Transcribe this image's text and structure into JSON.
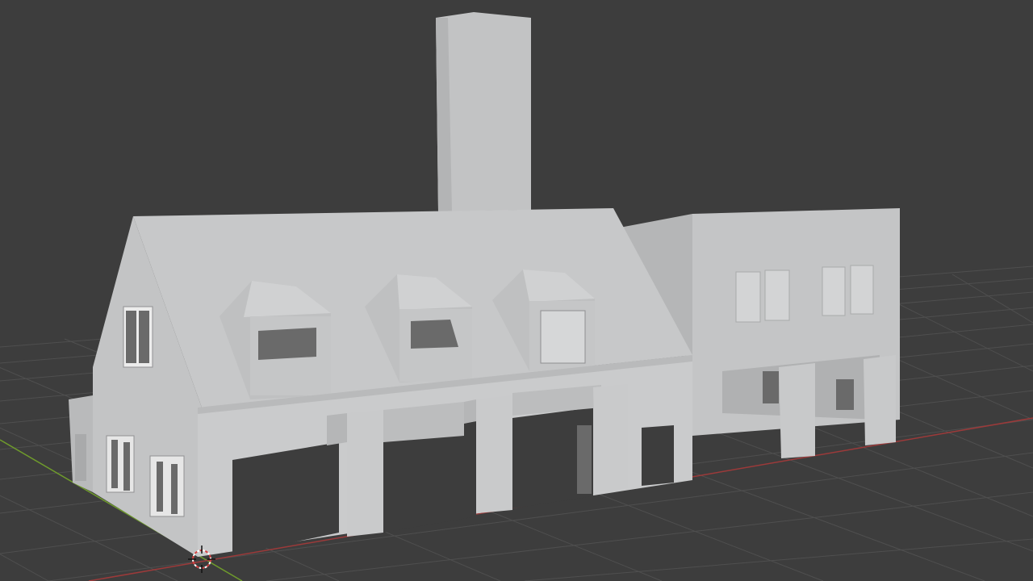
{
  "viewport": {
    "mode": "3d-viewport",
    "shading": "solid",
    "colors": {
      "background": "#3d3d3d",
      "grid_line": "#4e4e4e",
      "x_axis": "#9c3a3a",
      "y_axis": "#6f9b2c",
      "model_light": "#c9cacb",
      "model_mid": "#b7b8b9",
      "model_dark": "#a3a4a5",
      "opening": "#6a6a6a"
    },
    "objects": [
      {
        "name": "building-model",
        "description_icon": "mesh-icon"
      }
    ],
    "cursor": {
      "icon": "3d-cursor-icon"
    }
  }
}
